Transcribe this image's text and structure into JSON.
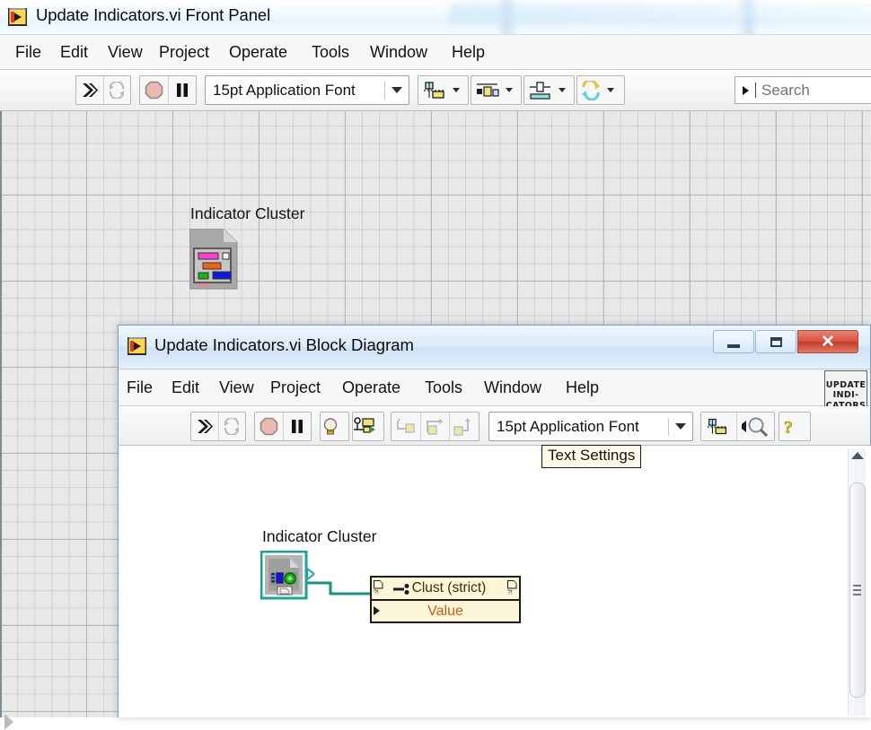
{
  "front_panel": {
    "title": "Update Indicators.vi Front Panel",
    "title_icon": "labview-vi-icon",
    "menu": [
      "File",
      "Edit",
      "View",
      "Project",
      "Operate",
      "Tools",
      "Window",
      "Help"
    ],
    "toolbar": {
      "run": "run-arrow-icon",
      "run_continuously": "run-continuously-icon",
      "abort": "abort-execution-icon",
      "pause": "pause-icon",
      "font_selector": "15pt Application Font",
      "align_objects": "align-objects-icon",
      "distribute_objects": "distribute-objects-icon",
      "resize_objects": "resize-objects-icon",
      "reorder": "reorder-objects-icon"
    },
    "search": {
      "placeholder": "Search",
      "icon": "search-expand-icon"
    },
    "canvas": {
      "cluster_label": "Indicator Cluster",
      "cluster_icon": "cluster-indicator-icon"
    }
  },
  "block_diagram": {
    "title": "Update Indicators.vi Block Diagram",
    "title_icon": "labview-vi-icon",
    "window_buttons": {
      "minimize": "minimize-icon",
      "maximize": "maximize-icon",
      "close": "✕"
    },
    "menu": [
      "File",
      "Edit",
      "View",
      "Project",
      "Operate",
      "Tools",
      "Window",
      "Help"
    ],
    "vi_icon_badge": [
      "UPDATE",
      "INDI-",
      "CATORS"
    ],
    "toolbar": {
      "run": "run-arrow-icon",
      "run_continuously": "run-continuously-icon",
      "abort": "abort-execution-icon",
      "pause": "pause-icon",
      "highlight_execution": "lightbulb-icon",
      "retain_wire_values": "retain-wire-values-icon",
      "step_into": "step-into-icon",
      "step_over": "step-over-icon",
      "step_out": "step-out-icon",
      "font_selector": "15pt Application Font",
      "align_objects": "align-objects-icon",
      "search_zoom": "magnifier-icon",
      "help": "context-help-icon"
    },
    "tooltip": "Text Settings",
    "canvas": {
      "cluster_label": "Indicator Cluster",
      "cluster_terminal_icon": "cluster-reference-terminal-icon",
      "property_node": {
        "header": "Clust (strict)",
        "property": "Value",
        "ref_icon": "reference-glyph-icon"
      }
    },
    "scrollbar": {
      "up_arrow": "scroll-up-icon",
      "thumb": "scroll-thumb"
    }
  },
  "colors": {
    "fp_canvas": "#e8e8e8",
    "bd_canvas": "#ffffff",
    "property_node_fill": "#fdf6d8",
    "property_node_text": "#3a3000",
    "property_value_text": "#cc5a22",
    "wire_teal": "#1a8f86",
    "selection_teal": "#19a39a",
    "close_button": "#c33a28",
    "titlebar_blue": "#cfe2f5"
  }
}
